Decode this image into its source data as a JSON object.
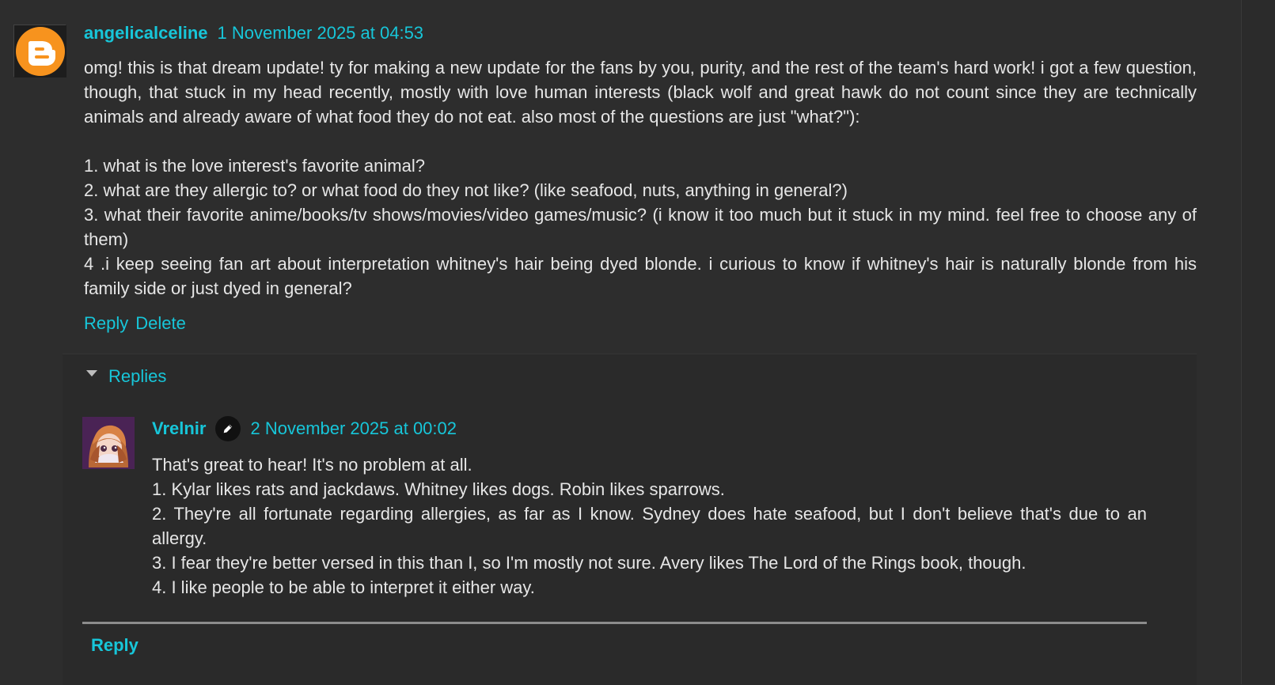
{
  "comment": {
    "author": "angelicalceline",
    "timestamp": "1 November 2025 at 04:53",
    "avatar_icon": "blogger-logo-icon",
    "paragraphs": [
      "omg! this is that dream update! ty for making a new update for the fans by you, purity, and the rest of the team's hard work! i got a few question, though, that stuck in my head recently, mostly with love human interests (black wolf and great hawk do not count since they are technically animals and already aware of what food they do not eat. also most of the questions are just \"what?\"):",
      "1. what is the love interest's favorite animal?",
      "2. what are they allergic to? or what food do they not like? (like seafood, nuts, anything in general?)",
      "3. what their favorite anime/books/tv shows/movies/video games/music? (i know it too much but it stuck in my mind. feel free to choose any of them)",
      "4 .i keep seeing fan art about interpretation whitney's hair being dyed blonde. i curious to know if whitney's hair is naturally blonde from his family side or just dyed in general?"
    ],
    "actions": {
      "reply": "Reply",
      "delete": "Delete"
    }
  },
  "replies": {
    "toggle_label": "Replies",
    "items": [
      {
        "author": "Vrelnir",
        "timestamp": "2 November 2025 at 00:02",
        "avatar_icon": "anime-avatar-icon",
        "badge_icon": "pencil-icon",
        "lines": [
          "That's great to hear! It's no problem at all.",
          "1. Kylar likes rats and jackdaws. Whitney likes dogs. Robin likes sparrows.",
          "2. They're all fortunate regarding allergies, as far as I know. Sydney does hate seafood, but I don't believe that's due to an allergy.",
          "3. I fear they're better versed in this than I, so I'm mostly not sure. Avery likes The Lord of the Rings book, though.",
          "4. I like people to be able to interpret it either way."
        ]
      }
    ],
    "footer_reply": "Reply"
  },
  "colors": {
    "background": "#2d2d2d",
    "panel": "#2a2a2a",
    "accent": "#17c6d9",
    "text": "#e6e6e6",
    "blogger_orange": "#f7931e"
  }
}
